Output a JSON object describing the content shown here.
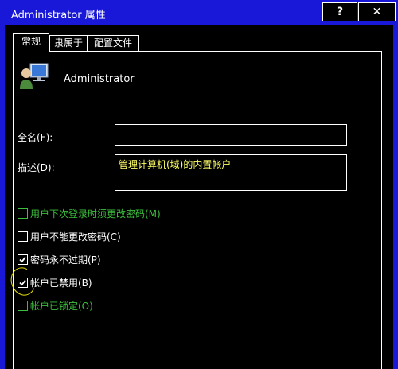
{
  "window": {
    "title": "Administrator 属性",
    "help_label": "?",
    "close_label": "✕"
  },
  "tabs": [
    {
      "label": "常规",
      "active": true
    },
    {
      "label": "隶属于",
      "active": false
    },
    {
      "label": "配置文件",
      "active": false
    }
  ],
  "general": {
    "username": "Administrator",
    "fullname_label": "全名(F):",
    "fullname_value": "",
    "description_label": "描述(D):",
    "description_value": "管理计算机(域)的内置帐户"
  },
  "options": [
    {
      "label": "用户下次登录时须更改密码(M)",
      "checked": false,
      "enabled": false
    },
    {
      "label": "用户不能更改密码(C)",
      "checked": false,
      "enabled": true
    },
    {
      "label": "密码永不过期(P)",
      "checked": true,
      "enabled": true
    },
    {
      "label": "帐户已禁用(B)",
      "checked": true,
      "enabled": true
    },
    {
      "label": "帐户已锁定(O)",
      "checked": false,
      "enabled": false
    }
  ],
  "colors": {
    "titlebar": "#1a18d8",
    "window_bg": "#000000",
    "disabled_text": "#3cbf3c",
    "description_text": "#ffff66",
    "annotation": "#e8e000"
  }
}
